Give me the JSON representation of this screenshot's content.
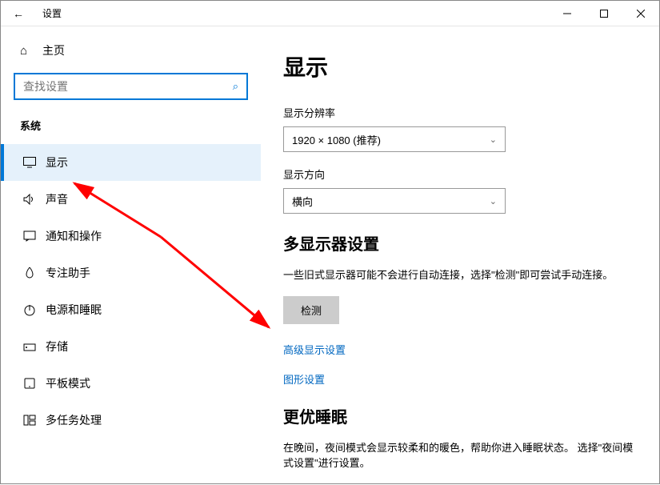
{
  "titlebar": {
    "back": "←",
    "title": "设置"
  },
  "sidebar": {
    "home_label": "主页",
    "search_placeholder": "查找设置",
    "category": "系统",
    "items": [
      {
        "label": "显示"
      },
      {
        "label": "声音"
      },
      {
        "label": "通知和操作"
      },
      {
        "label": "专注助手"
      },
      {
        "label": "电源和睡眠"
      },
      {
        "label": "存储"
      },
      {
        "label": "平板模式"
      },
      {
        "label": "多任务处理"
      }
    ]
  },
  "content": {
    "heading": "显示",
    "resolution_label": "显示分辨率",
    "resolution_value": "1920 × 1080 (推荐)",
    "orientation_label": "显示方向",
    "orientation_value": "横向",
    "multi_heading": "多显示器设置",
    "multi_desc": "一些旧式显示器可能不会进行自动连接，选择\"检测\"即可尝试手动连接。",
    "detect_btn": "检测",
    "adv_link": "高级显示设置",
    "gfx_link": "图形设置",
    "sleep_heading": "更优睡眠",
    "sleep_desc": "在晚间，夜间模式会显示较柔和的暖色，帮助你进入睡眠状态。 选择\"夜间模式设置\"进行设置。"
  }
}
